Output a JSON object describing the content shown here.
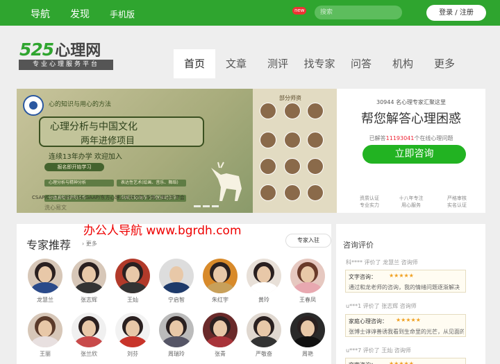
{
  "topbar": {
    "nav": [
      "导航",
      "发现",
      "手机版"
    ],
    "search_placeholder": "搜索",
    "login": "登录 / 注册"
  },
  "logo": {
    "number": "525",
    "name": "心理网",
    "tagline": "专业心理服务平台"
  },
  "main_nav": {
    "items": [
      "首页",
      "文章",
      "测评",
      "找专家",
      "问答",
      "机构",
      "更多"
    ],
    "active": "首页",
    "badge": "new"
  },
  "banner": {
    "tag": "心的知识与用心的方法",
    "title_line1": "心理分析与中国文化",
    "title_line2": "两年进修项目",
    "subline": "连续13年办学  欢迎加入",
    "badge": "报名即开始学习",
    "courses": [
      "心理分析与精神分析",
      "表达性艺术(绘画、音乐、舞蹈)",
      "沙盘游戏与梦的工作",
      "中国文化(易学与中医易经汉字)"
    ],
    "footer": "CSAP/CSST/IAEPA/ISE/GAAP/东方心理分析研究院/华南心理分析学会",
    "slogan": "洗心易文",
    "teachers_title": "部分师资"
  },
  "consult": {
    "count_text": "30944 名心理专家汇聚这里",
    "headline": "帮您解答心理困惑",
    "answered_prefix": "已解答",
    "answered_count": "11193041",
    "answered_suffix": "个在线心理问题",
    "button": "立即咨询",
    "features": [
      [
        "资质认证",
        "专业实力"
      ],
      [
        "十八年专注",
        "用心服务"
      ],
      [
        "严格审核",
        "实名认证"
      ]
    ]
  },
  "watermark": "办公人导航  www.bgrdh.com",
  "experts": {
    "title": "专家推荐",
    "more": "更多",
    "join": "专家入驻",
    "people": [
      "龙慧兰",
      "张志辉",
      "王灿",
      "宁启智",
      "朱红宇",
      "黄玲",
      "王春凤",
      "王丽",
      "张兰欣",
      "刘芬",
      "周瑞玲",
      "张青",
      "严敬奋",
      "周艳"
    ]
  },
  "reviews": {
    "title": "咨询评价",
    "items": [
      {
        "meta": "科**** 评价了 龙慧兰 咨询师",
        "type": "文字咨询：",
        "stars": "★★★★★",
        "text": "通过和龙老师的咨询，我的情绪问题逐渐解决"
      },
      {
        "meta": "u***1 评价了 张志辉 咨询师",
        "type": "家庭心理咨询：",
        "stars": "★★★★★",
        "text": "张博士谆谆善诱我看到生命里的光芒，从见面的那一"
      },
      {
        "meta": "u***7 评价了 王灿 咨询师",
        "type": "文字咨询：",
        "stars": "★★★★★",
        "text": ""
      }
    ]
  }
}
